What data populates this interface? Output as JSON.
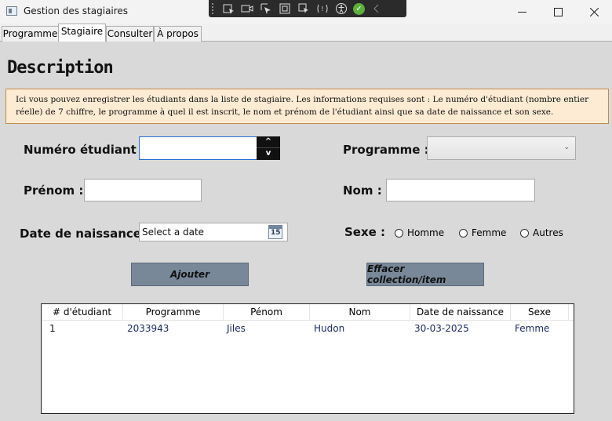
{
  "window": {
    "title": "Gestion des stagiaires"
  },
  "tabs": [
    {
      "label": "Programme"
    },
    {
      "label": "Stagiaire"
    },
    {
      "label": "Consulter"
    },
    {
      "label": "À propos"
    }
  ],
  "form": {
    "heading": "Description",
    "info_text": "Ici vous pouvez enregistrer les étudiants dans la liste de stagiaire. Les informations requises sont : Le numéro d'étudiant (nombre entier réelle) de 7 chiffre, le programme à quel il est inscrit, le nom et prénom de l'étudiant ainsi que sa date de naissance et son sexe.",
    "numero_label": "Numéro étudiant :",
    "numero_value": "",
    "spin_up": "^",
    "spin_down": "v",
    "programme_label": "Programme :",
    "programme_value": "",
    "prenom_label": "Prénom :",
    "prenom_value": "",
    "nom_label": "Nom :",
    "nom_value": "",
    "date_label": "Date de naissance :",
    "date_placeholder": "Select a date",
    "calendar_day": "15",
    "sexe_label": "Sexe :",
    "sexe_options": [
      {
        "label": "Homme",
        "checked": false
      },
      {
        "label": "Femme",
        "checked": false
      },
      {
        "label": "Autres",
        "checked": false
      }
    ],
    "add_button": "Ajouter",
    "clear_button": "Effacer collection/item"
  },
  "table": {
    "columns": [
      "# d'étudiant",
      "Programme",
      "Pénom",
      "Nom",
      "Date de naissance",
      "Sexe"
    ],
    "rows": [
      [
        "1",
        "2033943",
        "Jiles",
        "Hudon",
        "30-03-2025",
        "Femme"
      ]
    ]
  }
}
